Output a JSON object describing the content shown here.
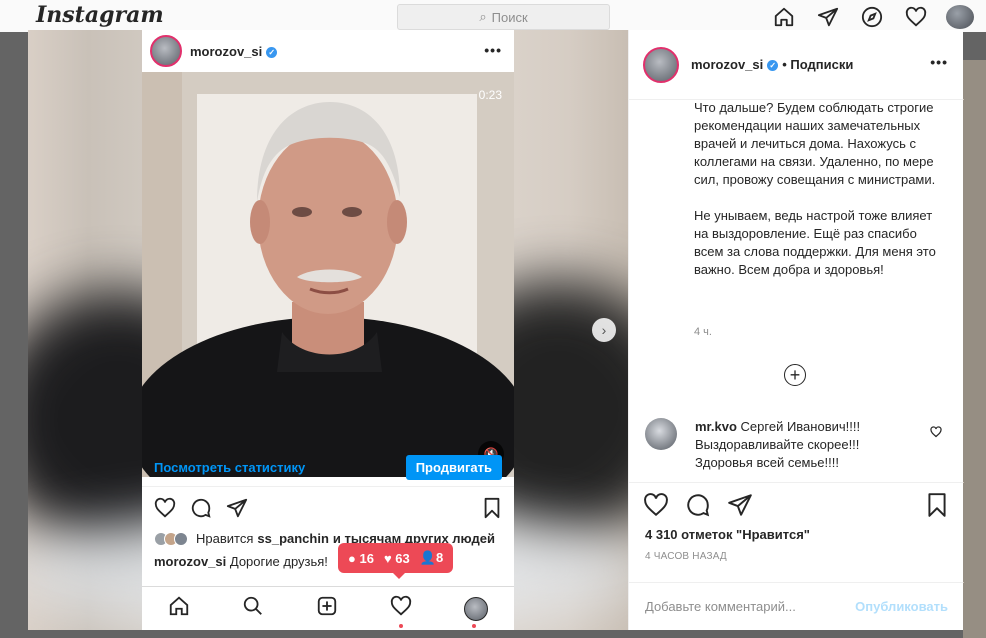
{
  "topbar": {
    "logo": "Instagram",
    "search_placeholder": "Поиск",
    "nav_icons": [
      "home-icon",
      "direct-icon",
      "explore-icon",
      "activity-heart-icon",
      "profile-avatar"
    ]
  },
  "phone": {
    "username": "morozov_si",
    "video_timer": "0:23",
    "stats_link": "Посмотреть статистику",
    "promote_button": "Продвигать",
    "likes_prefix": "Нравится",
    "likes_user": "ss_panchin",
    "likes_suffix": "и тысячам других людей",
    "caption_user": "morozov_si",
    "caption_text": "Дорогие друзья!",
    "notifications": {
      "comments": "16",
      "likes": "63",
      "follows": "8"
    }
  },
  "panel": {
    "username": "morozov_si",
    "follow_label": "• Подписки",
    "caption_paragraphs": [
      "Что дальше? Будем соблюдать строгие рекомендации наших замечательных врачей и лечиться дома. Нахожусь с коллегами на связи. Удаленно, по мере сил, провожу совещания с министрами.",
      "Не унываем, ведь настрой тоже влияет на выздоровление. Ещё раз спасибо всем за слова поддержки. Для меня это важно. Всем добра и здоровья!"
    ],
    "time_ago": "4 ч.",
    "comment": {
      "user": "mr.kvo",
      "text": "Сергей Иванович!!!! Выздоравливайте скорее!!! Здоровья всей семье!!!!"
    },
    "likes": "4 310 отметок \"Нравится\"",
    "posted": "4 ЧАСОВ НАЗАД",
    "comment_placeholder": "Добавьте комментарий...",
    "publish_button": "Опубликовать"
  },
  "colors": {
    "accent": "#0095f6",
    "notification": "#ed4956",
    "verified": "#3897f0"
  }
}
